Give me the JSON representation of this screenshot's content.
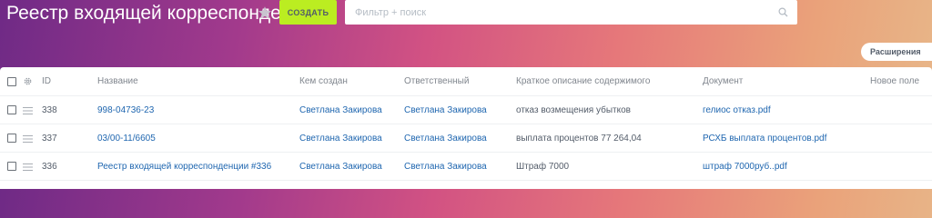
{
  "header": {
    "title": "Реестр входящей корреспонденции",
    "create_label": "СОЗДАТЬ",
    "search_placeholder": "Фильтр + поиск",
    "extensions_label": "Расширения"
  },
  "grid": {
    "columns": {
      "id": "ID",
      "name": "Название",
      "created_by": "Кем создан",
      "responsible": "Ответственный",
      "description": "Краткое описание содержимого",
      "document": "Документ",
      "new_field": "Новое поле"
    },
    "rows": [
      {
        "id": "338",
        "name": "998-04736-23",
        "created_by": "Светлана Закирова",
        "responsible": "Светлана Закирова",
        "description": "отказ возмещения убытков",
        "document": "гелиос отказ.pdf"
      },
      {
        "id": "337",
        "name": "03/00-11/6605",
        "created_by": "Светлана Закирова",
        "responsible": "Светлана Закирова",
        "description": "выплата процентов 77 264,04",
        "document": "РСХБ выплата процентов.pdf"
      },
      {
        "id": "336",
        "name": "Реестр входящей корреспонденции #336",
        "created_by": "Светлана Закирова",
        "responsible": "Светлана Закирова",
        "description": "Штраф 7000",
        "document": "штраф 7000руб..pdf"
      }
    ]
  }
}
